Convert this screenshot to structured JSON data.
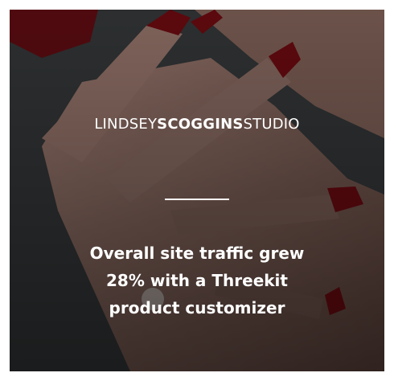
{
  "logo": {
    "part1": "LINDSEY",
    "part2": "SCOGGINS",
    "part3": "STUDIO"
  },
  "headline": {
    "line1": "Overall site traffic grew",
    "line2": "28% with a Threekit",
    "line3": "product customizer"
  },
  "colors": {
    "text": "#ffffff",
    "nail_polish": "#7a0c12",
    "skin": "#8a6a60",
    "background": "#2f3234"
  }
}
